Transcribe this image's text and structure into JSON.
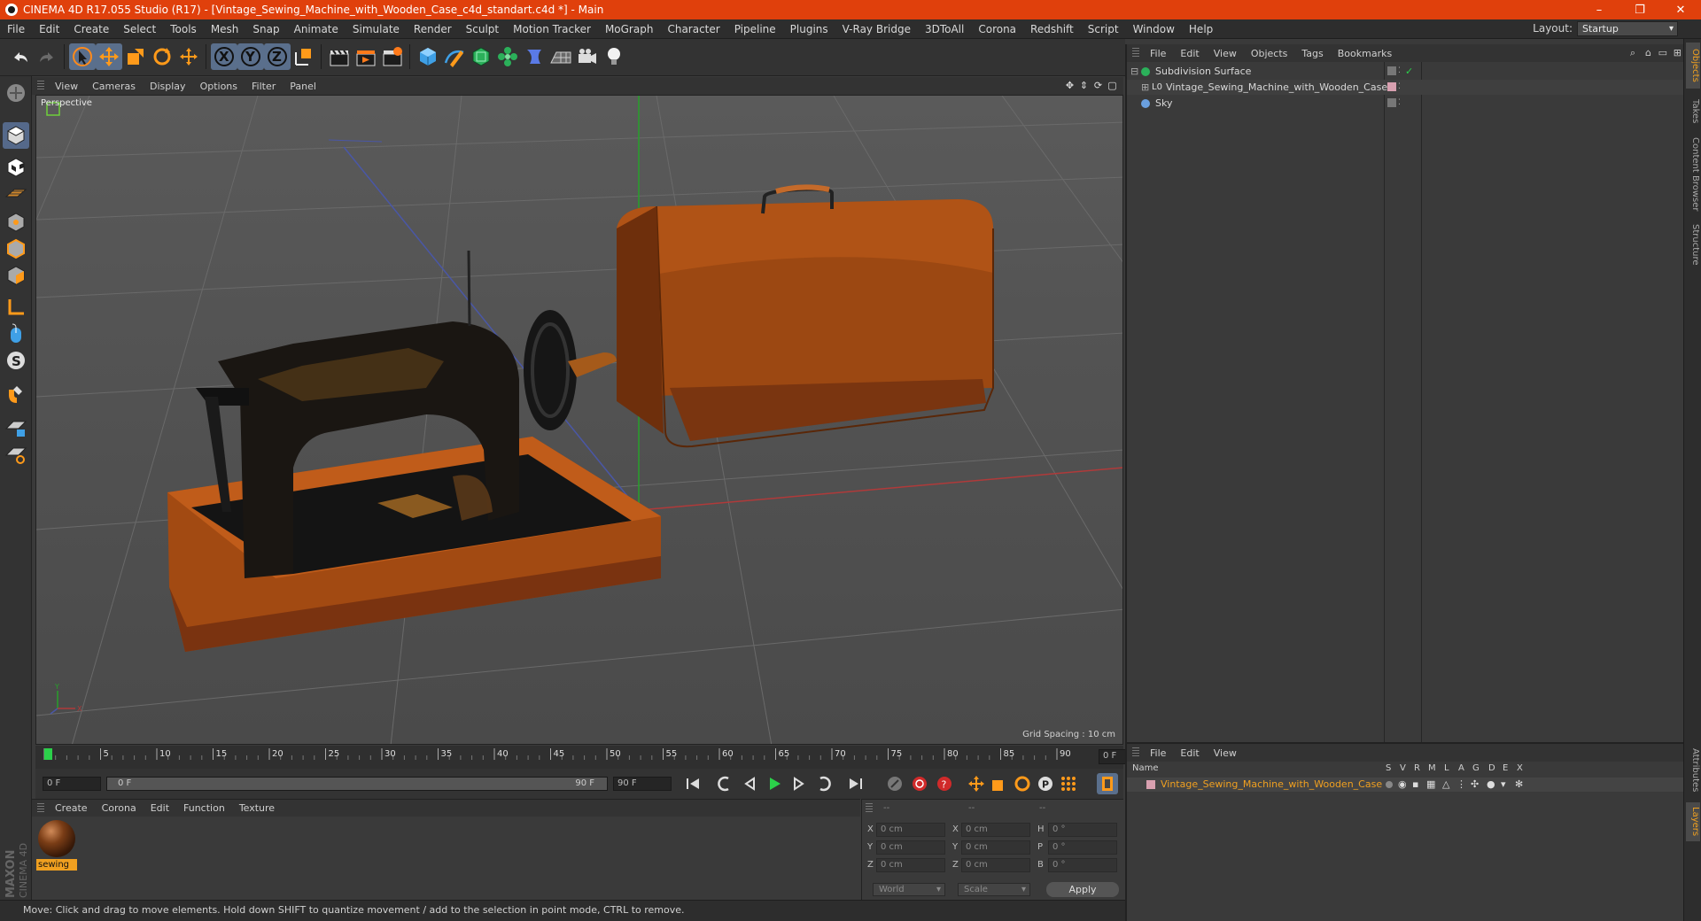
{
  "title_bar": {
    "title": "CINEMA 4D R17.055 Studio (R17) - [Vintage_Sewing_Machine_with_Wooden_Case_c4d_standart.c4d *] - Main",
    "minimize": "–",
    "restore": "❐",
    "close": "✕"
  },
  "menubar": {
    "items": [
      "File",
      "Edit",
      "Create",
      "Select",
      "Tools",
      "Mesh",
      "Snap",
      "Animate",
      "Simulate",
      "Render",
      "Sculpt",
      "Motion Tracker",
      "MoGraph",
      "Character",
      "Pipeline",
      "Plugins",
      "V-Ray Bridge",
      "3DToAll",
      "Corona",
      "Redshift",
      "Script",
      "Window",
      "Help"
    ],
    "layout_label": "Layout:",
    "layout_value": "Startup"
  },
  "toolbar": {
    "axis_x": "X",
    "axis_y": "Y",
    "axis_z": "Z"
  },
  "viewport": {
    "menu": [
      "View",
      "Cameras",
      "Display",
      "Options",
      "Filter",
      "Panel"
    ],
    "camera_label": "Perspective",
    "grid_spacing": "Grid Spacing : 10 cm",
    "axis_labels": {
      "y": "Y",
      "x": "X"
    }
  },
  "timeline": {
    "ticks": [
      "0",
      "5",
      "10",
      "15",
      "20",
      "25",
      "30",
      "35",
      "40",
      "45",
      "50",
      "55",
      "60",
      "65",
      "70",
      "75",
      "80",
      "85",
      "90"
    ],
    "current_frame": "0 F",
    "start_field": "0 F",
    "range_start": "0 F",
    "range_end": "90 F",
    "end_field": "90 F"
  },
  "material_manager": {
    "menu": [
      "Create",
      "Corona",
      "Edit",
      "Function",
      "Texture"
    ],
    "materials": [
      {
        "name": "sewing"
      }
    ]
  },
  "coordinates": {
    "headers": [
      "--",
      "--",
      "--"
    ],
    "rows": [
      {
        "pos_label": "X",
        "pos": "0 cm",
        "size_label": "X",
        "size": "0 cm",
        "rot_label": "H",
        "rot": "0 °"
      },
      {
        "pos_label": "Y",
        "pos": "0 cm",
        "size_label": "Y",
        "size": "0 cm",
        "rot_label": "P",
        "rot": "0 °"
      },
      {
        "pos_label": "Z",
        "pos": "0 cm",
        "size_label": "Z",
        "size": "0 cm",
        "rot_label": "B",
        "rot": "0 °"
      }
    ],
    "mode_world": "World",
    "mode_scale": "Scale",
    "apply": "Apply"
  },
  "status_bar": {
    "text": "Move: Click and drag to move elements. Hold down SHIFT to quantize movement / add to the selection in point mode, CTRL to remove."
  },
  "object_manager": {
    "menu": [
      "File",
      "Edit",
      "View",
      "Objects",
      "Tags",
      "Bookmarks"
    ],
    "objects": [
      {
        "name": "Subdivision Surface"
      },
      {
        "name": "Vintage_Sewing_Machine_with_Wooden_Case"
      },
      {
        "name": "Sky"
      }
    ]
  },
  "layer_manager": {
    "menu": [
      "File",
      "Edit",
      "View"
    ],
    "columns": [
      "Name",
      "S",
      "V",
      "R",
      "M",
      "L",
      "A",
      "G",
      "D",
      "E",
      "X"
    ],
    "layers": [
      {
        "name": "Vintage_Sewing_Machine_with_Wooden_Case"
      }
    ]
  },
  "right_tabs": [
    "Objects",
    "Takes",
    "Content Browser",
    "Structure",
    "Attributes",
    "Layers"
  ],
  "maxon_logo": [
    "MAXON",
    "CINEMA 4D"
  ],
  "colors": {
    "titlebar": "#e0400c",
    "accent": "#f0a020",
    "active_tool": "#5a6f8c",
    "wood": "#8a3e10"
  }
}
